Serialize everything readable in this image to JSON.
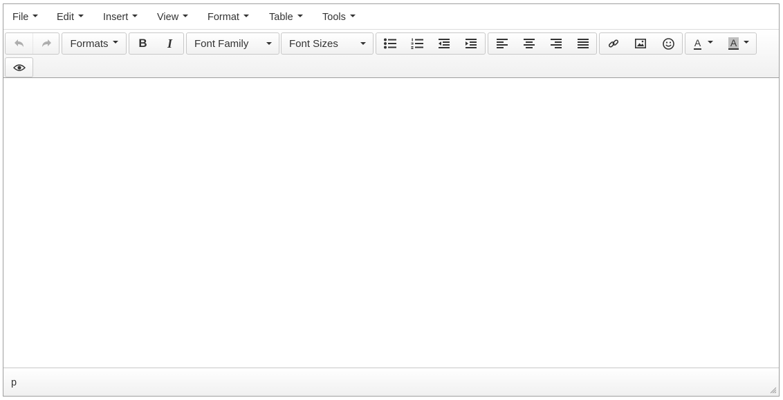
{
  "menubar": {
    "items": [
      {
        "label": "File"
      },
      {
        "label": "Edit"
      },
      {
        "label": "Insert"
      },
      {
        "label": "View"
      },
      {
        "label": "Format"
      },
      {
        "label": "Table"
      },
      {
        "label": "Tools"
      }
    ]
  },
  "toolbar": {
    "formats_label": "Formats",
    "bold_label": "B",
    "italic_label": "I",
    "font_family_label": "Font Family",
    "font_sizes_label": "Font Sizes",
    "text_color_label": "A",
    "background_color_label": "A",
    "undo_icon": "undo-icon",
    "redo_icon": "redo-icon",
    "preview_icon": "eye-icon"
  },
  "colors": {
    "text_color_underline": "#333333",
    "background_color_swatch": "#bfbfbf",
    "border": "#9e9e9e"
  },
  "statusbar": {
    "path": "p"
  }
}
